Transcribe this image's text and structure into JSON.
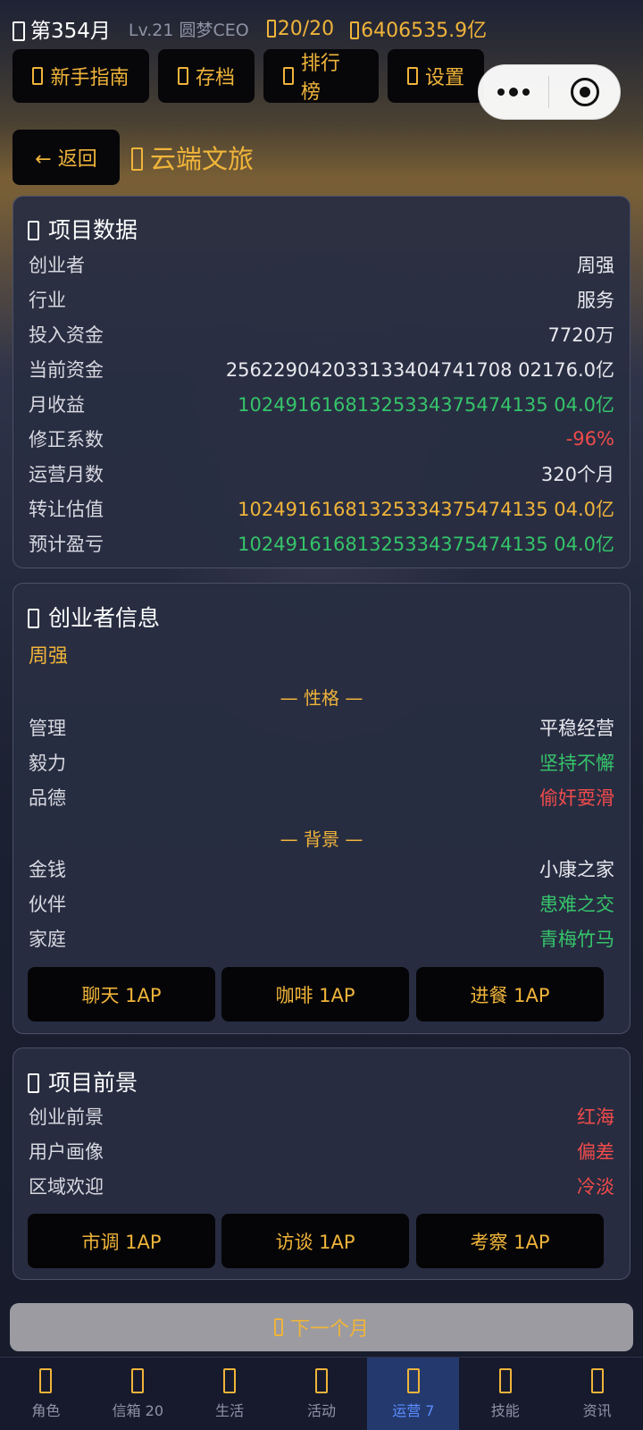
{
  "header": {
    "month": "第354月",
    "level": "Lv.21 圆梦CEO",
    "action_points": "20/20",
    "money": "6406535.9亿"
  },
  "topnav": [
    "新手指南",
    "存档",
    "排行榜",
    "设置"
  ],
  "back_label": "← 返回",
  "page_title": "云端文旅",
  "project_data": {
    "title": "项目数据",
    "rows": [
      {
        "k": "创业者",
        "v": "周强"
      },
      {
        "k": "行业",
        "v": "服务"
      },
      {
        "k": "投入资金",
        "v": "7720万"
      },
      {
        "k": "当前资金",
        "v": "256229042033133404741708 02176.0亿"
      },
      {
        "k": "月收益",
        "v": "10249161681325334375474135 04.0亿"
      },
      {
        "k": "修正系数",
        "v": "-96%"
      },
      {
        "k": "运营月数",
        "v": "320个月"
      },
      {
        "k": "转让估值",
        "v": "10249161681325334375474135 04.0亿"
      },
      {
        "k": "预计盈亏",
        "v": "10249161681325334375474135 04.0亿"
      }
    ]
  },
  "founder": {
    "title": "创业者信息",
    "name": "周强",
    "personality_label": "— 性格 —",
    "personality": [
      {
        "k": "管理",
        "v": "平稳经营"
      },
      {
        "k": "毅力",
        "v": "坚持不懈"
      },
      {
        "k": "品德",
        "v": "偷奸耍滑"
      }
    ],
    "background_label": "— 背景 —",
    "background": [
      {
        "k": "金钱",
        "v": "小康之家"
      },
      {
        "k": "伙伴",
        "v": "患难之交"
      },
      {
        "k": "家庭",
        "v": "青梅竹马"
      }
    ],
    "actions": [
      "聊天 1AP",
      "咖啡 1AP",
      "进餐 1AP"
    ]
  },
  "outlook": {
    "title": "项目前景",
    "rows": [
      {
        "k": "创业前景",
        "v": "红海"
      },
      {
        "k": "用户画像",
        "v": "偏差"
      },
      {
        "k": "区域欢迎",
        "v": "冷淡"
      }
    ],
    "actions": [
      "市调 1AP",
      "访谈 1AP",
      "考察 1AP"
    ]
  },
  "next_month": "下一个月",
  "tabs": [
    "角色",
    "信箱 20",
    "生活",
    "活动",
    "运营 7",
    "技能",
    "资讯"
  ],
  "colors": {
    "gold": "#f0b43a",
    "green": "#35c46a",
    "red": "#ef4b4b",
    "active_tab": "#5b8cff"
  }
}
